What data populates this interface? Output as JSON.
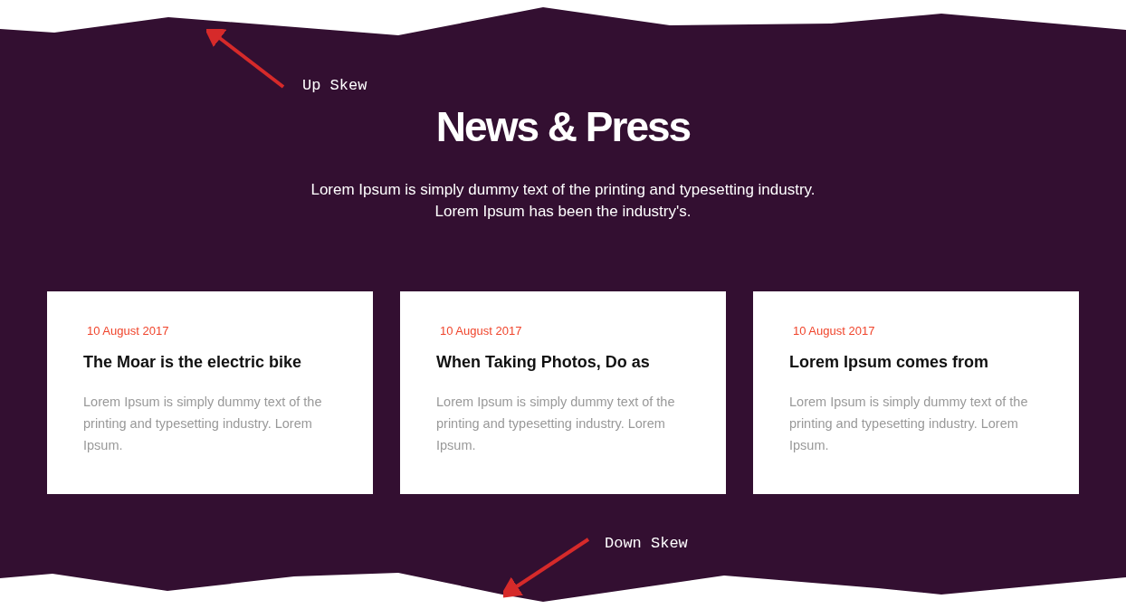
{
  "section": {
    "title": "News & Press",
    "subtitle": "Lorem Ipsum is simply dummy text of the printing and typesetting industry. Lorem Ipsum has been the industry's."
  },
  "cards": [
    {
      "date": "10 August 2017",
      "title": "The Moar is the electric bike",
      "excerpt": "Lorem Ipsum is simply dummy text of the printing and typesetting industry. Lorem Ipsum."
    },
    {
      "date": "10 August 2017",
      "title": "When Taking Photos, Do as",
      "excerpt": "Lorem Ipsum is simply dummy text of the printing and typesetting industry. Lorem Ipsum."
    },
    {
      "date": "10 August 2017",
      "title": "Lorem Ipsum comes from",
      "excerpt": "Lorem Ipsum is simply dummy text of the printing and typesetting industry. Lorem Ipsum."
    }
  ],
  "annotations": [
    {
      "kind": "up",
      "label": "Up Skew"
    },
    {
      "kind": "down",
      "label": "Down Skew"
    }
  ]
}
